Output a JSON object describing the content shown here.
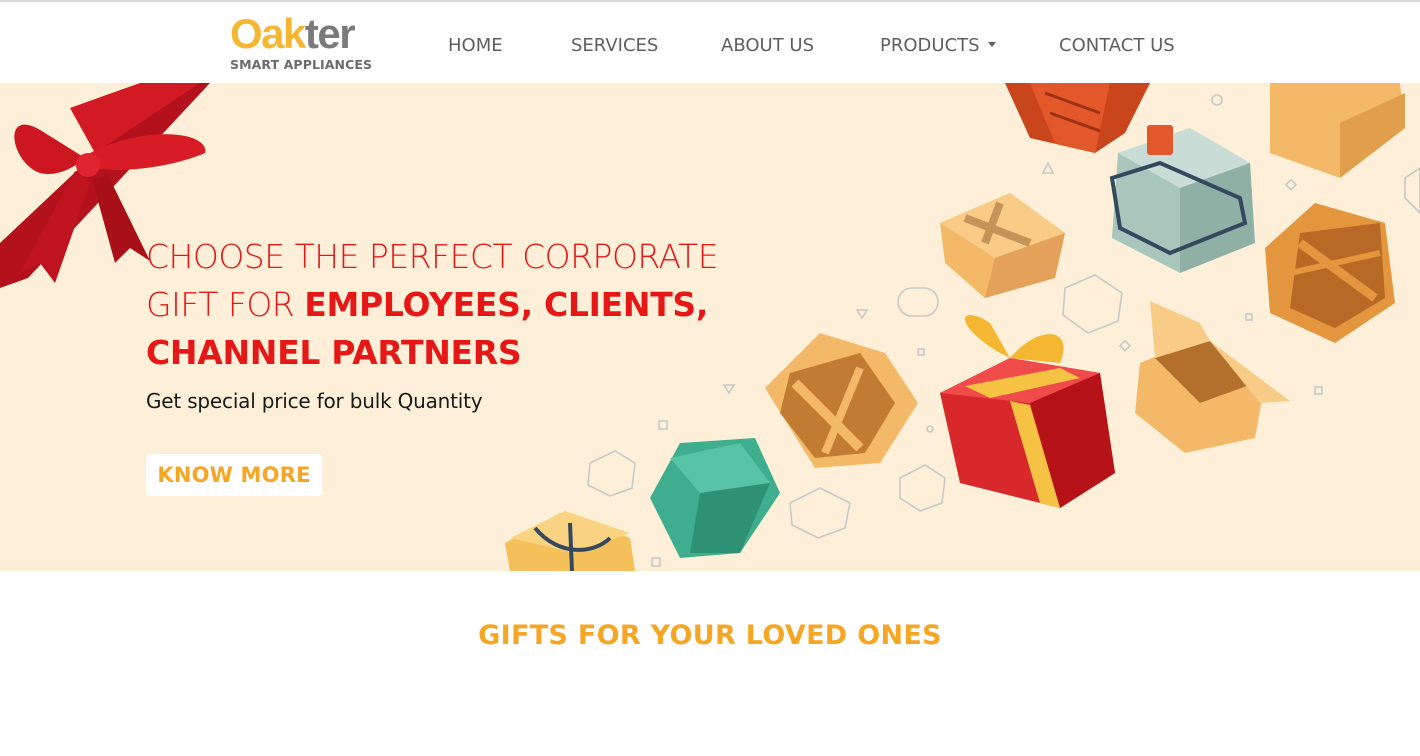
{
  "brand": {
    "logo_part1": "Oak",
    "logo_part2": "ter",
    "tagline": "SMART APPLIANCES"
  },
  "nav": {
    "home": "HOME",
    "services": "SERVICES",
    "about": "ABOUT US",
    "products": "PRODUCTS",
    "contact": "CONTACT US"
  },
  "hero": {
    "line1": "CHOOSE THE PERFECT CORPORATE",
    "line2_light": "GIFT FOR ",
    "line2_bold": "EMPLOYEES, CLIENTS,",
    "line3_bold": "CHANNEL PARTNERS",
    "subtext": "Get special price for bulk Quantity",
    "cta": "KNOW MORE"
  },
  "section": {
    "title": "GIFTS FOR YOUR LOVED ONES"
  },
  "colors": {
    "brand_yellow": "#f5b731",
    "accent_orange": "#f5a623",
    "headline_red": "#e51717",
    "hero_bg": "#fef0d8"
  }
}
